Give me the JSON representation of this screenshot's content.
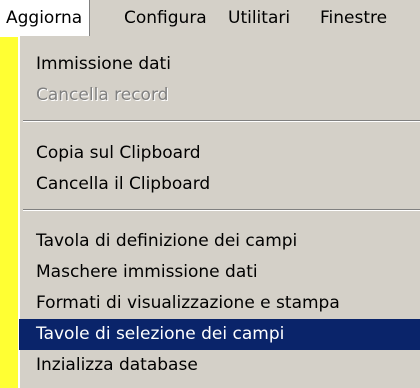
{
  "colors": {
    "background": "#ffff33",
    "menu_face": "#d4d0c8",
    "highlight": "#0a246a",
    "highlight_text": "#ffffff",
    "disabled_text": "#808080"
  },
  "menubar": {
    "items": [
      {
        "label": "Aggiorna",
        "state": "open"
      },
      {
        "label": "Configura"
      },
      {
        "label": "Utilitari"
      },
      {
        "label": "Finestre"
      }
    ]
  },
  "menu": {
    "items": [
      {
        "label": "Immissione dati"
      },
      {
        "label": "Cancella record",
        "disabled": true
      },
      {
        "label": "Copia sul Clipboard"
      },
      {
        "label": "Cancella il Clipboard"
      },
      {
        "label": "Tavola di definizione dei campi"
      },
      {
        "label": "Maschere immissione dati"
      },
      {
        "label": "Formati di visualizzazione e stampa"
      },
      {
        "label": "Tavole di selezione dei campi",
        "selected": true
      },
      {
        "label": "Inzializza database"
      }
    ]
  }
}
